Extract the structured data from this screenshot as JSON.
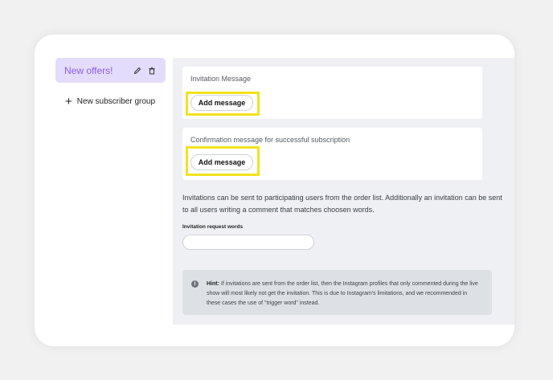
{
  "sidebar": {
    "groups": [
      {
        "name": "New offers!",
        "edit_icon": "pencil-icon",
        "delete_icon": "trash-icon"
      }
    ],
    "new_group_label": "New subscriber group",
    "new_group_icon": "plus-icon"
  },
  "invitation": {
    "title": "Invitation Message",
    "button_label": "Add message"
  },
  "confirmation": {
    "title": "Confirmation message for successful subscription",
    "button_label": "Add message"
  },
  "description": "Invitations can be sent to participating users from the order list. Additionally an invitation can be sent to all users writing a comment that matches choosen words.",
  "request_words": {
    "label": "Invitation request words",
    "value": "",
    "placeholder": ""
  },
  "hint": {
    "icon": "info-icon",
    "prefix": "Hint:",
    "text": " If invitations are sent from the order list, then the Instagram profiles that only commented during the live show will most likely not get the invitation. This is due to Instagram's limitations, and we recommended in these cases the use of \"trigger word\" instead."
  },
  "colors": {
    "accent": "#8a5cf0",
    "selected_group_bg": "#e4dcfb",
    "highlight": "#f2e21d",
    "panel_bg": "#eef0f3",
    "hint_bg": "#dde1e6"
  }
}
